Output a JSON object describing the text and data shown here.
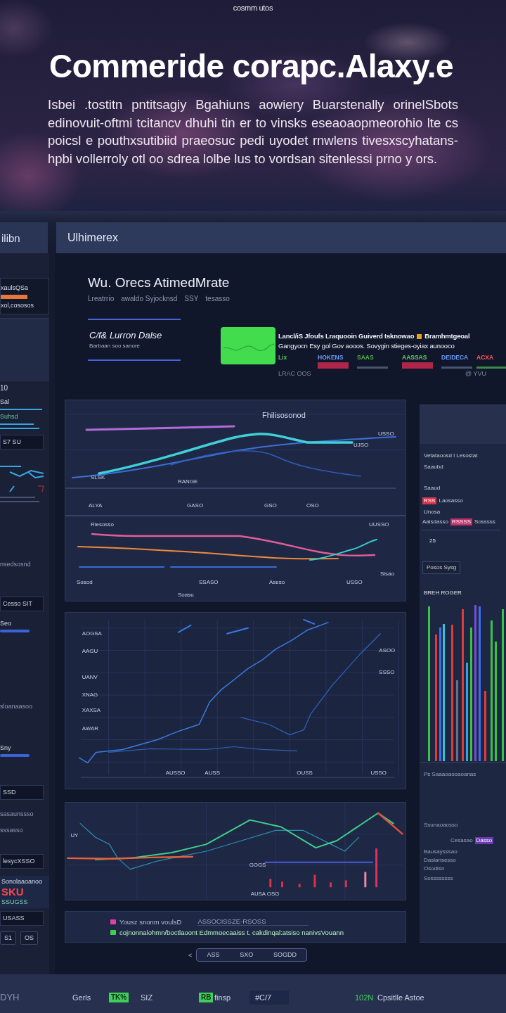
{
  "hero": {
    "eyebrow": "cosmm utos",
    "title": "Commeride corapc.Alaxy.e",
    "paragraph": "Isbei .tostitn pntitsagiy Bgahiuns aowiery Buarstenally orinelSbots edinovuit-oftmi tcitancv dhuhi tin er to vinsks eseaoaopmeorohio lte cs poicsl e pouthxsutibiid praeosuc pedi uyodet rnwlens tivesxscyhatans-hpbi vollerroly otl oo sdrea lolbe lus to vordsan sitenlessi prno y ors."
  },
  "header": {
    "sidebar_title": "ilibn",
    "title": "Ulhimerex"
  },
  "sidebar": {
    "items": [
      {
        "kind": "stat",
        "label": "xaulsQSa",
        "caption": "xol,cososos"
      },
      {
        "kind": "tile",
        "label": "10"
      },
      {
        "kind": "lines",
        "label": "Sal",
        "caption": "Suhsd"
      },
      {
        "kind": "box",
        "label": "S7 SU"
      },
      {
        "kind": "spark"
      },
      {
        "kind": "text",
        "label": "nsedsosnd"
      },
      {
        "kind": "box",
        "label": "Cesso SIT"
      },
      {
        "kind": "meter",
        "label": "Seo"
      },
      {
        "kind": "text",
        "label": "sloanaasoo"
      },
      {
        "kind": "meter",
        "label": "Sny"
      },
      {
        "kind": "box",
        "label": "SSD"
      },
      {
        "kind": "text",
        "label": "sasaunssso"
      },
      {
        "kind": "text",
        "label": "sssasso"
      },
      {
        "kind": "box",
        "label": "lesycXSSO"
      },
      {
        "kind": "alert",
        "label": "Sonolaaoanoo",
        "value": "SKU",
        "caption": "SSUGSS"
      },
      {
        "kind": "box",
        "label": "USASS"
      },
      {
        "kind": "buttons",
        "buttons": [
          "S1",
          "OS"
        ]
      }
    ]
  },
  "summary": {
    "title": "Wu. Orecs AtimedMrate",
    "meta": [
      "Lreatrrio",
      "awaldo Syjocknsd",
      "SSY",
      "tesasso"
    ],
    "card": {
      "title": "C/f& Lurron Dalse",
      "caption": "Barbaan soo sanore"
    },
    "info": {
      "line_1": "Lancl/iS Jfoufs Lraquooin Guiverd tsknowao",
      "tag": "Bramhmtgeoal",
      "line_2": "Gangyocn Esy gol Gov aooos. Sovygin stieges-oyiax aunooco"
    },
    "stats": [
      {
        "label": "Lix",
        "color": "#5fbf5f"
      },
      {
        "label": "HOKENS",
        "color": "#6c9cff"
      },
      {
        "label": "SAAS",
        "color": "#4cb84c"
      },
      {
        "label": "AASSAS",
        "color": "#62d062"
      },
      {
        "label": "DEIDECA",
        "color": "#6c9cff"
      },
      {
        "label": "ACXA",
        "color": "#ff5a5a"
      }
    ],
    "footer_left": "LRAC OOS",
    "footer_right": "@ YVU"
  },
  "trend_panel": {
    "title": "Fhilisosonod",
    "upper_labels": [
      "SLSK",
      "RANGE",
      "USSO",
      "UJSO"
    ],
    "x_labels": [
      "ALYA",
      "GASO",
      "GSO",
      "OSO"
    ],
    "lower_labels": [
      "Riesosso",
      "UUSSO",
      "Sisao"
    ],
    "lower_x_labels": [
      "Sosod",
      "SSASO",
      "Aseso",
      "USSO"
    ],
    "caption": "Soasu"
  },
  "scatter_panel": {
    "y_labels": [
      "AOGSA",
      "AAGU",
      "UANV",
      "XNAG",
      "XAXSA",
      "AWAR"
    ],
    "x_labels": [
      "AUSSO",
      "AUSS",
      "OUSS",
      "USSO"
    ],
    "right_labels": [
      "ASOO",
      "SSSO"
    ]
  },
  "wave_panel": {
    "labels": [
      "UY",
      "GOGS",
      "AUSA OSG"
    ]
  },
  "legend": [
    {
      "color": "#e23fa8",
      "text": "Yousz snonm voulsD",
      "note": "ASSOCISSZE-RSOSS"
    },
    {
      "color": "#3fd04f",
      "text": "cojnonnalohmn/boctlaoont Edmmoecaaiss t. cakdinqal:atsiso nanivsVouann"
    }
  ],
  "pagination": {
    "previous": "<",
    "pages": [
      "ASS",
      "SXO",
      "SOGDD"
    ]
  },
  "side_panel": {
    "heading": "Vetataoosd l Lesostat",
    "sub": "Saaubd",
    "rows": [
      {
        "kind": "text",
        "text": "Saaud"
      },
      {
        "kind": "tagged",
        "tag": "RSS",
        "text": "Laosasso"
      },
      {
        "kind": "text",
        "text": "Unosa"
      },
      {
        "kind": "marked",
        "text": "Aaisdasso",
        "tag": "RSSSS",
        "note": "Sosssss"
      },
      {
        "kind": "value",
        "text": "25"
      },
      {
        "kind": "button",
        "text": "Posos Sysg"
      }
    ],
    "chart_title": "BREH ROGER",
    "footer": [
      {
        "kind": "text",
        "text": "Ps Saaaoaooaoanas"
      },
      {
        "kind": "text",
        "text": "Ssunaoaosso"
      },
      {
        "kind": "badge",
        "text": "Cesasao",
        "tag": "Dasso"
      },
      {
        "kind": "text",
        "text": "Bausaysssao"
      },
      {
        "kind": "text",
        "text": "Dasiansesso"
      },
      {
        "kind": "text",
        "text": "Osodisn"
      },
      {
        "kind": "text",
        "text": "Sossssssss"
      }
    ]
  },
  "status_bar": [
    {
      "kind": "text",
      "text": "DYH"
    },
    {
      "kind": "text",
      "text": "Gerls"
    },
    {
      "kind": "badge",
      "text": "TK%"
    },
    {
      "kind": "text",
      "text": "SIZ"
    },
    {
      "kind": "badge",
      "text": "RB"
    },
    {
      "kind": "text",
      "text": "finsp"
    },
    {
      "kind": "field",
      "text": "#C/7"
    },
    {
      "kind": "accent",
      "text": "102N"
    },
    {
      "kind": "text",
      "text": "Cpsitlle Astoe"
    }
  ]
}
